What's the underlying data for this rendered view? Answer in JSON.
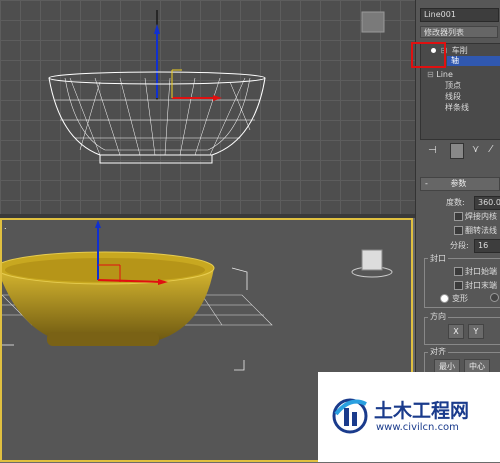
{
  "top_viewport": {
    "label": ""
  },
  "persp_viewport": {
    "label": "."
  },
  "panel": {
    "object_name": "Line001",
    "modifier_list": "修改器列表",
    "stack": {
      "lathe": "车削",
      "axis": "轴",
      "line": "Line",
      "vertex": "顶点",
      "segment": "线段",
      "spline": "样条线"
    },
    "params": {
      "header_sign": "-",
      "header": "参数",
      "degrees_label": "度数:",
      "degrees_value": "360.0",
      "weld_core": "焊接内核",
      "flip_normals": "翻转法线",
      "segments_label": "分段:",
      "segments_value": "16",
      "cap_group": "封口",
      "cap_start": "封口始端",
      "cap_end": "封口末端",
      "morph": "变形",
      "direction_group": "方向",
      "dir_x": "X",
      "dir_y": "Y",
      "align_group": "对齐",
      "align_min": "最小",
      "align_center": "中心"
    }
  },
  "watermark": {
    "title": "土木工程网",
    "url": "www.civilcn.com"
  },
  "colors": {
    "highlight": "#e01010",
    "viewport_border": "#e0c040",
    "bowl": "#c8a820",
    "logo": "#1a3b8c"
  }
}
